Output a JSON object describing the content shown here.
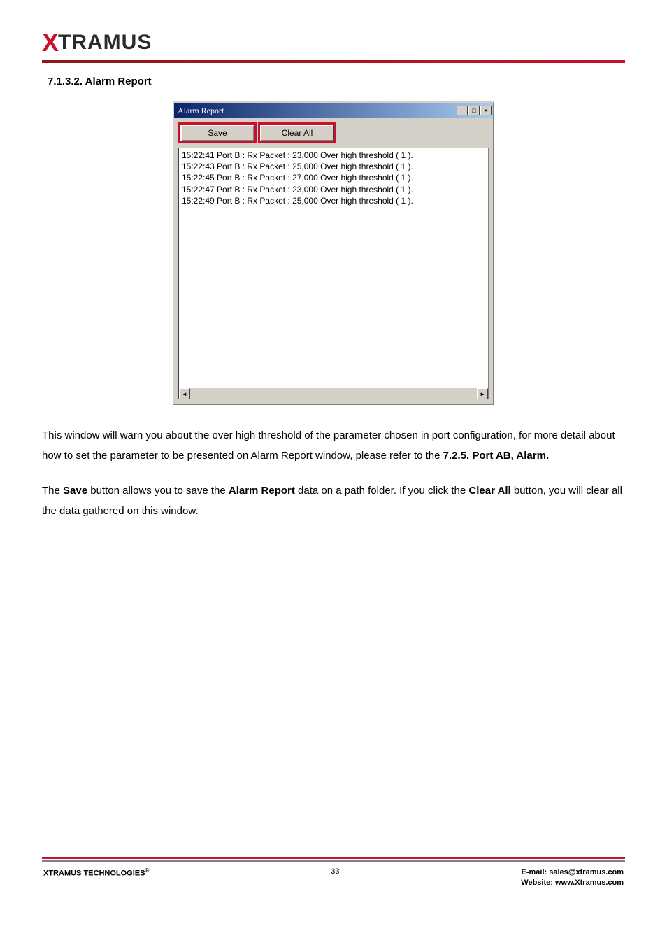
{
  "logo": {
    "prefix": "X",
    "rest": "TRAMUS"
  },
  "section_heading": "7.1.3.2. Alarm Report",
  "alarm_window": {
    "title": "Alarm Report",
    "titlebar_buttons": {
      "min": "_",
      "max": "□",
      "close": "×"
    },
    "toolbar": {
      "save": "Save",
      "clear_all": "Clear All"
    },
    "log_lines": [
      "15:22:41 Port B : Rx Packet : 23,000 Over high threshold ( 1 ).",
      "15:22:43 Port B : Rx Packet : 25,000 Over high threshold ( 1 ).",
      "15:22:45 Port B : Rx Packet : 27,000 Over high threshold ( 1 ).",
      "15:22:47 Port B : Rx Packet : 23,000 Over high threshold ( 1 ).",
      "15:22:49 Port B : Rx Packet : 25,000 Over high threshold ( 1 )."
    ],
    "hscroll": {
      "left": "◄",
      "right": "►"
    }
  },
  "paragraph1": {
    "t1": "This window will warn you about the over high threshold of the parameter chosen in port configuration, for more detail about how to set the parameter to be presented on Alarm Report window, please refer to the ",
    "b1": "7.2.5. Port AB, Alarm."
  },
  "paragraph2": {
    "t1": "The ",
    "b1": "Save",
    "t2": " button allows you to save the ",
    "b2": "Alarm Report",
    "t3": " data on a path folder. If you click the ",
    "b3": "Clear All",
    "t4": " button, you will clear all the data gathered on this window."
  },
  "footer": {
    "left": "XTRAMUS TECHNOLOGIES",
    "left_sup": "®",
    "center": "33",
    "right_line1": "E-mail: sales@xtramus.com",
    "right_line2": "Website:  www.Xtramus.com"
  }
}
